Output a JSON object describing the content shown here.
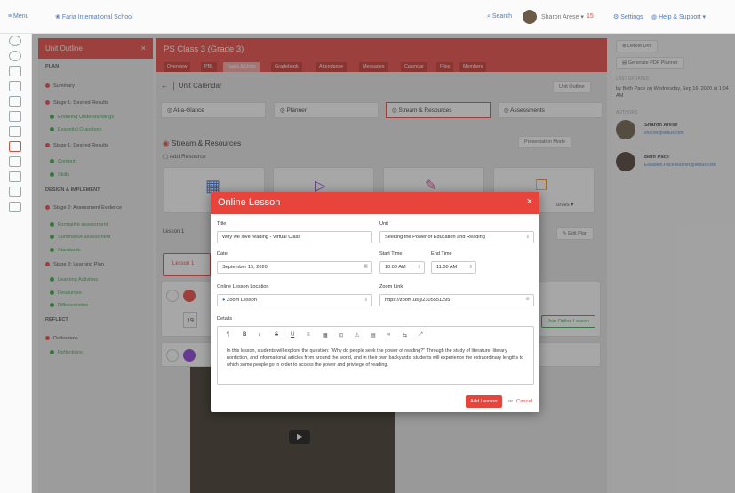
{
  "topbar": {
    "menu": "≡ Menu",
    "school": "Faria International School",
    "search": "Search",
    "user": "Sharon Arese",
    "notif": "15",
    "settings": "Settings",
    "help": "Help & Support"
  },
  "sidebar": {
    "title": "Unit Outline",
    "sections": [
      {
        "label": "PLAN"
      },
      {
        "label": "DESIGN & IMPLEMENT"
      },
      {
        "label": "REFLECT"
      }
    ],
    "items": [
      {
        "label": "Summary",
        "color": "#e9443c"
      },
      {
        "label": "Stage 1: Desired Results",
        "color": "#e9443c"
      },
      {
        "label": "Enduring Understandings",
        "color": "#3aa24a"
      },
      {
        "label": "Essential Questions",
        "color": "#3aa24a"
      },
      {
        "label": "Stage 1: Desired Results",
        "color": "#e9443c"
      },
      {
        "label": "Content",
        "color": "#3aa24a"
      },
      {
        "label": "Skills",
        "color": "#3aa24a"
      },
      {
        "label": "Stage 2: Assessment Evidence",
        "color": "#e9443c"
      },
      {
        "label": "Formative assessment",
        "color": "#3aa24a"
      },
      {
        "label": "Summative assessment",
        "color": "#3aa24a"
      },
      {
        "label": "Standards",
        "color": "#3aa24a"
      },
      {
        "label": "Stage 3: Learning Plan",
        "color": "#e9443c"
      },
      {
        "label": "Learning Activities",
        "color": "#3aa24a"
      },
      {
        "label": "Resources",
        "color": "#3aa24a"
      },
      {
        "label": "Differentiation",
        "color": "#3aa24a"
      },
      {
        "label": "Reflections",
        "color": "#e9443c"
      },
      {
        "label": "Reflections",
        "color": "#3aa24a"
      }
    ]
  },
  "header": {
    "class_title": "PS Class 3 (Grade 3)",
    "tabs": [
      "Overview",
      "PBL",
      "Tasks & Units",
      "Gradebook",
      "Attendance",
      "Messages",
      "Calendar",
      "Files",
      "Members"
    ]
  },
  "unit": {
    "back": "Unit Calendar",
    "outline_btn": "Unit Outline",
    "views": [
      "At-a-Glance",
      "Planner",
      "Stream & Resources",
      "Assessments"
    ],
    "stream_title": "Stream & Resources",
    "add_resource": "Add Resource",
    "presentation": "Presentation Mode",
    "lesson_label": "Lesson 1",
    "edit_plan": "Edit Plan",
    "lesson_tab": "Lesson 1",
    "date_day": "19",
    "join": "Join Online Lesson",
    "more_label": "urces"
  },
  "rightpanel": {
    "delete": "Delete Unit",
    "pdf": "Generate PDF Planner",
    "last_updated_label": "LAST UPDATED",
    "last_updated": "by Beth Pace on Wednesday, Sep 16, 2020 at 1:04 AM",
    "authors_label": "AUTHORS",
    "authors": [
      {
        "name": "Sharon Arese",
        "email": "sharon@ekbus.com"
      },
      {
        "name": "Beth Pace",
        "email": "Elisabeth.Pace.teacher@ekbus.com"
      }
    ]
  },
  "modal": {
    "title": "Online Lesson",
    "close": "×",
    "title_label": "Title",
    "title_value": "Why we love reading - Virtual Class",
    "unit_label": "Unit",
    "unit_value": "Seeking the Power of Education and Reading",
    "date_label": "Date",
    "date_value": "September 19, 2020",
    "start_label": "Start Time",
    "start_value": "10:00 AM",
    "end_label": "End Time",
    "end_value": "11:00 AM",
    "location_label": "Online Lesson Location",
    "location_value": "Zoom Lesson",
    "zoom_label": "Zoom Link",
    "zoom_value": "https://zoom.us/j/2305551295",
    "details_label": "Details",
    "toolbar": [
      "¶",
      "B",
      "I",
      "S",
      "U",
      "≡",
      "▦",
      "⊡",
      "⚠",
      "▤",
      "∞",
      "⇆",
      "⤢"
    ],
    "details": "In this lesson, students will explore the question: \"Why do people seek the power of reading?\" Through the study of literature, literary nonfiction, and informational articles from around the world, and in their own backyards, students will experience the extraordinary lengths to which some people go in order to access the power and privilege of reading.",
    "add_btn": "Add Lesson",
    "or": "or",
    "cancel": "Cancel"
  }
}
